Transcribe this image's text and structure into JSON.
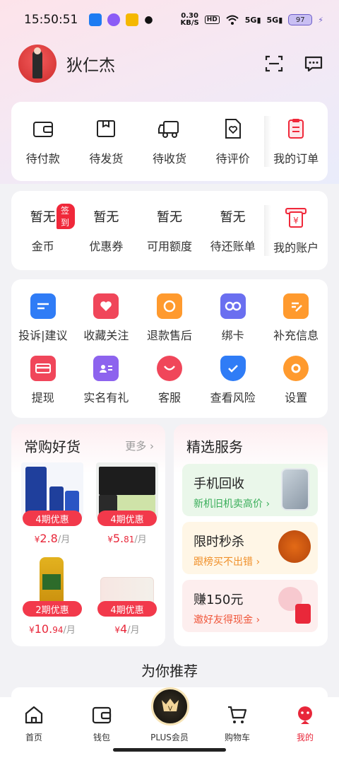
{
  "status_bar": {
    "time": "15:50:51",
    "speed_value": "0.30",
    "speed_unit": "KB/S",
    "hd": "HD",
    "net1": "5G",
    "net2": "5G",
    "battery": "97"
  },
  "header": {
    "username": "狄仁杰"
  },
  "orders": {
    "items": [
      {
        "label": "待付款",
        "icon": "wallet-icon"
      },
      {
        "label": "待发货",
        "icon": "package-icon"
      },
      {
        "label": "待收货",
        "icon": "truck-icon"
      },
      {
        "label": "待评价",
        "icon": "review-icon"
      },
      {
        "label": "我的订单",
        "icon": "order-list-icon"
      }
    ]
  },
  "assets": {
    "badge": "签到",
    "items": [
      {
        "value": "暂无",
        "label": "金币"
      },
      {
        "value": "暂无",
        "label": "优惠券"
      },
      {
        "value": "暂无",
        "label": "可用额度"
      },
      {
        "value": "暂无",
        "label": "待还账单"
      }
    ],
    "account_label": "我的账户"
  },
  "tools": {
    "items": [
      {
        "label": "投诉|建议",
        "icon": "complaint-icon",
        "color": "#2f7cf6"
      },
      {
        "label": "收藏关注",
        "icon": "favorite-icon",
        "color": "#f0465a"
      },
      {
        "label": "退款售后",
        "icon": "refund-icon",
        "color": "#ff9a2e"
      },
      {
        "label": "绑卡",
        "icon": "bind-card-icon",
        "color": "#6a6ff0"
      },
      {
        "label": "补充信息",
        "icon": "edit-info-icon",
        "color": "#ff9a2e"
      },
      {
        "label": "提现",
        "icon": "withdraw-icon",
        "color": "#f0465a"
      },
      {
        "label": "实名有礼",
        "icon": "id-card-icon",
        "color": "#8d63ee"
      },
      {
        "label": "客服",
        "icon": "service-icon",
        "color": "#f0465a"
      },
      {
        "label": "查看风险",
        "icon": "shield-icon",
        "color": "#2f7cf6"
      },
      {
        "label": "设置",
        "icon": "gear-icon",
        "color": "#ff9a2e"
      }
    ]
  },
  "frequent": {
    "title": "常购好货",
    "more": "更多",
    "products": [
      {
        "tag": "4期优惠",
        "price_int": "2.8",
        "price_dec": "",
        "unit": "/月"
      },
      {
        "tag": "4期优惠",
        "price_int": "5.",
        "price_dec": "81",
        "unit": "/月"
      },
      {
        "tag": "2期优惠",
        "price_int": "10.",
        "price_dec": "94",
        "unit": "/月"
      },
      {
        "tag": "4期优惠",
        "price_int": "4",
        "price_dec": "",
        "unit": "/月"
      }
    ],
    "currency": "¥"
  },
  "services": {
    "title": "精选服务",
    "items": [
      {
        "title": "手机回收",
        "sub": "新机旧机卖高价",
        "bg": "#eaf7ea",
        "sub_color": "#3aae5a"
      },
      {
        "title": "限时秒杀",
        "sub": "跟榜买不出错",
        "bg": "#fff6e6",
        "sub_color": "#f0902a"
      },
      {
        "title": "赚150元",
        "sub": "邀好友得现金",
        "bg": "#fdeeee",
        "sub_color": "#f0563a"
      }
    ]
  },
  "recommend_title": "为你推荐",
  "tabbar": {
    "items": [
      {
        "label": "首页",
        "icon": "home-icon"
      },
      {
        "label": "钱包",
        "icon": "wallet-tab-icon"
      },
      {
        "label": "PLUS会员",
        "icon": "plus-member-icon"
      },
      {
        "label": "购物车",
        "icon": "cart-icon"
      },
      {
        "label": "我的",
        "icon": "profile-icon"
      }
    ],
    "active_color": "#e8273a"
  }
}
